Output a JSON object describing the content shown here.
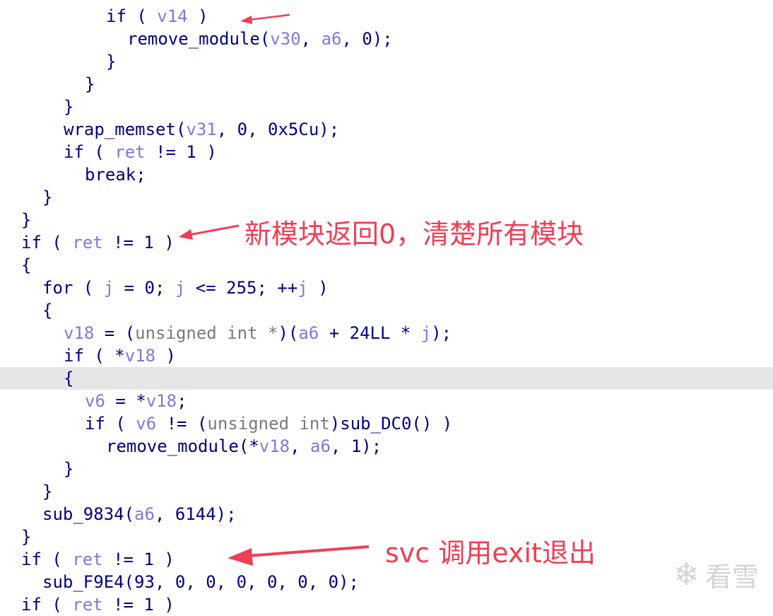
{
  "code_lines": [
    {
      "indent": 4,
      "tokens": [
        [
          "kw",
          "if"
        ],
        [
          "punct",
          " ( "
        ],
        [
          "var",
          "v14"
        ],
        [
          "punct",
          " )"
        ]
      ]
    },
    {
      "indent": 5,
      "tokens": [
        [
          "fn",
          "remove_module"
        ],
        [
          "punct",
          "("
        ],
        [
          "var",
          "v30"
        ],
        [
          "punct",
          ", "
        ],
        [
          "var",
          "a6"
        ],
        [
          "punct",
          ", "
        ],
        [
          "num",
          "0"
        ],
        [
          "punct",
          ");"
        ]
      ]
    },
    {
      "indent": 4,
      "tokens": [
        [
          "punct",
          "}"
        ]
      ]
    },
    {
      "indent": 3,
      "tokens": [
        [
          "punct",
          "}"
        ]
      ]
    },
    {
      "indent": 2,
      "tokens": [
        [
          "punct",
          "}"
        ]
      ]
    },
    {
      "indent": 2,
      "tokens": [
        [
          "fn",
          "wrap_memset"
        ],
        [
          "punct",
          "("
        ],
        [
          "var",
          "v31"
        ],
        [
          "punct",
          ", "
        ],
        [
          "num",
          "0"
        ],
        [
          "punct",
          ", "
        ],
        [
          "num",
          "0x5Cu"
        ],
        [
          "punct",
          ");"
        ]
      ]
    },
    {
      "indent": 2,
      "tokens": [
        [
          "kw",
          "if"
        ],
        [
          "punct",
          " ( "
        ],
        [
          "var",
          "ret"
        ],
        [
          "punct",
          " != "
        ],
        [
          "num",
          "1"
        ],
        [
          "punct",
          " )"
        ]
      ]
    },
    {
      "indent": 3,
      "tokens": [
        [
          "kw",
          "break"
        ],
        [
          "punct",
          ";"
        ]
      ]
    },
    {
      "indent": 1,
      "tokens": [
        [
          "punct",
          "}"
        ]
      ]
    },
    {
      "indent": 0,
      "tokens": [
        [
          "punct",
          "}"
        ]
      ]
    },
    {
      "indent": 0,
      "tokens": [
        [
          "kw",
          "if"
        ],
        [
          "punct",
          " ( "
        ],
        [
          "var",
          "ret"
        ],
        [
          "punct",
          " != "
        ],
        [
          "num",
          "1"
        ],
        [
          "punct",
          " )"
        ]
      ]
    },
    {
      "indent": 0,
      "tokens": [
        [
          "punct",
          "{"
        ]
      ]
    },
    {
      "indent": 1,
      "tokens": [
        [
          "kw",
          "for"
        ],
        [
          "punct",
          " ( "
        ],
        [
          "var",
          "j"
        ],
        [
          "punct",
          " = "
        ],
        [
          "num",
          "0"
        ],
        [
          "punct",
          "; "
        ],
        [
          "var",
          "j"
        ],
        [
          "punct",
          " <= "
        ],
        [
          "num",
          "255"
        ],
        [
          "punct",
          "; ++"
        ],
        [
          "var",
          "j"
        ],
        [
          "punct",
          " )"
        ]
      ]
    },
    {
      "indent": 1,
      "tokens": [
        [
          "punct",
          "{"
        ]
      ]
    },
    {
      "indent": 2,
      "tokens": [
        [
          "var",
          "v18"
        ],
        [
          "punct",
          " = ("
        ],
        [
          "type",
          "unsigned int *"
        ],
        [
          "punct",
          ")("
        ],
        [
          "var",
          "a6"
        ],
        [
          "punct",
          " + "
        ],
        [
          "num",
          "24LL"
        ],
        [
          "punct",
          " * "
        ],
        [
          "var",
          "j"
        ],
        [
          "punct",
          ");"
        ]
      ]
    },
    {
      "indent": 2,
      "tokens": [
        [
          "kw",
          "if"
        ],
        [
          "punct",
          " ( *"
        ],
        [
          "var",
          "v18"
        ],
        [
          "punct",
          " )"
        ]
      ]
    },
    {
      "indent": 2,
      "highlight": true,
      "tokens": [
        [
          "punct",
          "{"
        ]
      ]
    },
    {
      "indent": 3,
      "tokens": [
        [
          "var",
          "v6"
        ],
        [
          "punct",
          " = *"
        ],
        [
          "var",
          "v18"
        ],
        [
          "punct",
          ";"
        ]
      ]
    },
    {
      "indent": 3,
      "tokens": [
        [
          "kw",
          "if"
        ],
        [
          "punct",
          " ( "
        ],
        [
          "var",
          "v6"
        ],
        [
          "punct",
          " != ("
        ],
        [
          "type",
          "unsigned int"
        ],
        [
          "punct",
          ")"
        ],
        [
          "fn",
          "sub_DC0"
        ],
        [
          "punct",
          "() )"
        ]
      ]
    },
    {
      "indent": 4,
      "tokens": [
        [
          "fn",
          "remove_module"
        ],
        [
          "punct",
          "(*"
        ],
        [
          "var",
          "v18"
        ],
        [
          "punct",
          ", "
        ],
        [
          "var",
          "a6"
        ],
        [
          "punct",
          ", "
        ],
        [
          "num",
          "1"
        ],
        [
          "punct",
          ");"
        ]
      ]
    },
    {
      "indent": 2,
      "tokens": [
        [
          "punct",
          "}"
        ]
      ]
    },
    {
      "indent": 1,
      "tokens": [
        [
          "punct",
          "}"
        ]
      ]
    },
    {
      "indent": 1,
      "tokens": [
        [
          "fn",
          "sub_9834"
        ],
        [
          "punct",
          "("
        ],
        [
          "var",
          "a6"
        ],
        [
          "punct",
          ", "
        ],
        [
          "num",
          "6144"
        ],
        [
          "punct",
          ");"
        ]
      ]
    },
    {
      "indent": 0,
      "tokens": [
        [
          "punct",
          "}"
        ]
      ]
    },
    {
      "indent": 0,
      "tokens": [
        [
          "kw",
          "if"
        ],
        [
          "punct",
          " ( "
        ],
        [
          "var",
          "ret"
        ],
        [
          "punct",
          " != "
        ],
        [
          "num",
          "1"
        ],
        [
          "punct",
          " )"
        ]
      ]
    },
    {
      "indent": 1,
      "tokens": [
        [
          "fn",
          "sub_F9E4"
        ],
        [
          "punct",
          "("
        ],
        [
          "num",
          "93"
        ],
        [
          "punct",
          ", "
        ],
        [
          "num",
          "0"
        ],
        [
          "punct",
          ", "
        ],
        [
          "num",
          "0"
        ],
        [
          "punct",
          ", "
        ],
        [
          "num",
          "0"
        ],
        [
          "punct",
          ", "
        ],
        [
          "num",
          "0"
        ],
        [
          "punct",
          ", "
        ],
        [
          "num",
          "0"
        ],
        [
          "punct",
          ", "
        ],
        [
          "num",
          "0"
        ],
        [
          "punct",
          ");"
        ]
      ]
    },
    {
      "indent": 0,
      "tokens": [
        [
          "kw",
          "if"
        ],
        [
          "punct",
          " ( "
        ],
        [
          "var",
          "ret"
        ],
        [
          "punct",
          " != "
        ],
        [
          "num",
          "1"
        ],
        [
          "punct",
          " )"
        ]
      ]
    }
  ],
  "annotations": [
    {
      "text": "新模块返回0，清楚所有模块"
    },
    {
      "text": "svc 调用exit退出"
    }
  ],
  "watermark": {
    "icon": "snowflake-icon",
    "text": "看雪"
  },
  "colors": {
    "accent_red": "#ef3f55",
    "code_dark": "#000080",
    "code_var": "#7b7bd9",
    "code_type": "#7a7a7a",
    "highlight": "#e6e6e6"
  }
}
